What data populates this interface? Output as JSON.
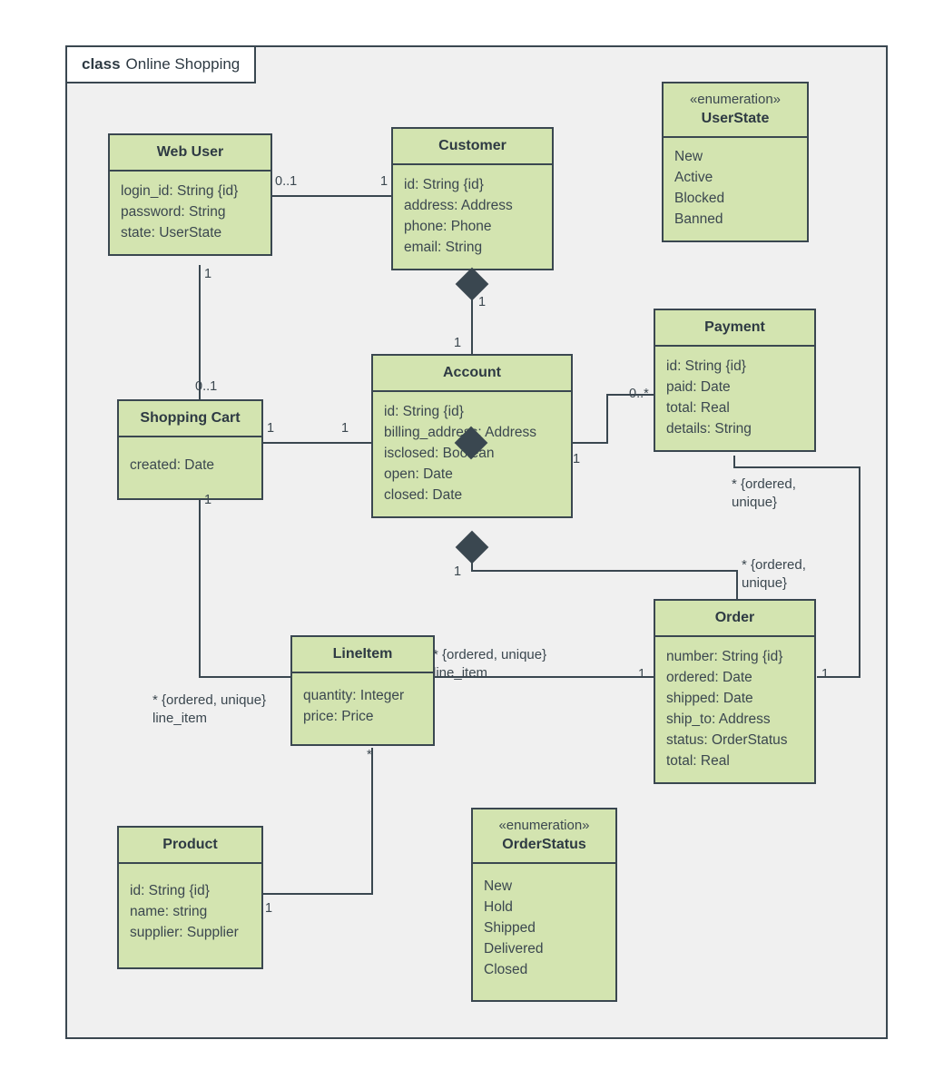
{
  "frame": {
    "keyword": "class",
    "name": "Online Shopping"
  },
  "classes": {
    "web_user": {
      "name": "Web User",
      "attrs": [
        "login_id: String {id}",
        "password: String",
        "state: UserState"
      ]
    },
    "customer": {
      "name": "Customer",
      "attrs": [
        "id: String {id}",
        "address: Address",
        "phone: Phone",
        "email: String"
      ]
    },
    "account": {
      "name": "Account",
      "attrs": [
        "id: String {id}",
        "billing_address: Address",
        "isclosed: Boolean",
        "open: Date",
        "closed: Date"
      ]
    },
    "payment": {
      "name": "Payment",
      "attrs": [
        "id: String {id}",
        "paid: Date",
        "total: Real",
        "details: String"
      ]
    },
    "shopping_cart": {
      "name": "Shopping Cart",
      "attrs": [
        "created: Date"
      ]
    },
    "order": {
      "name": "Order",
      "attrs": [
        "number: String {id}",
        "ordered: Date",
        "shipped: Date",
        "ship_to: Address",
        "status: OrderStatus",
        "total: Real"
      ]
    },
    "line_item": {
      "name": "LineItem",
      "attrs": [
        "quantity: Integer",
        "price: Price"
      ]
    },
    "product": {
      "name": "Product",
      "attrs": [
        "id: String {id}",
        "name: string",
        "supplier: Supplier"
      ]
    }
  },
  "enums": {
    "user_state": {
      "stereotype": "«enumeration»",
      "name": "UserState",
      "literals": [
        "New",
        "Active",
        "Blocked",
        "Banned"
      ]
    },
    "order_status": {
      "stereotype": "«enumeration»",
      "name": "OrderStatus",
      "literals": [
        "New",
        "Hold",
        "Shipped",
        "Delivered",
        "Closed"
      ]
    }
  },
  "multiplicities": {
    "webuser_to_customer_src": "0..1",
    "webuser_to_customer_tgt": "1",
    "webuser_to_cart_top": "1",
    "cart_from_webuser": "0..1",
    "cart_to_account": "1",
    "account_from_cart": "1",
    "customer_to_account": "1",
    "account_from_customer": "1",
    "account_to_payment": "0..*",
    "account_right_order": "1",
    "account_to_order": "1",
    "order_left_lineitem": "1",
    "order_right_payment": "1",
    "cart_to_lineitem": "1",
    "lineitem_to_product": "*",
    "product_to_lineitem": "1"
  },
  "edge_labels": {
    "payment_ordered_unique": {
      "line1": "* {ordered,",
      "line2": "unique}"
    },
    "order_ordered_unique": {
      "line1": "* {ordered,",
      "line2": "unique}"
    },
    "lineitem_right_ordered": {
      "line1": "* {ordered, unique}",
      "line2": "line_item"
    },
    "lineitem_left_ordered": {
      "line1": "* {ordered, unique}",
      "line2": "line_item"
    }
  },
  "colors": {
    "class_fill": "#d3e4b0",
    "border": "#3a4750",
    "frame_bg": "#f0f0f0",
    "text": "#3b474f"
  }
}
